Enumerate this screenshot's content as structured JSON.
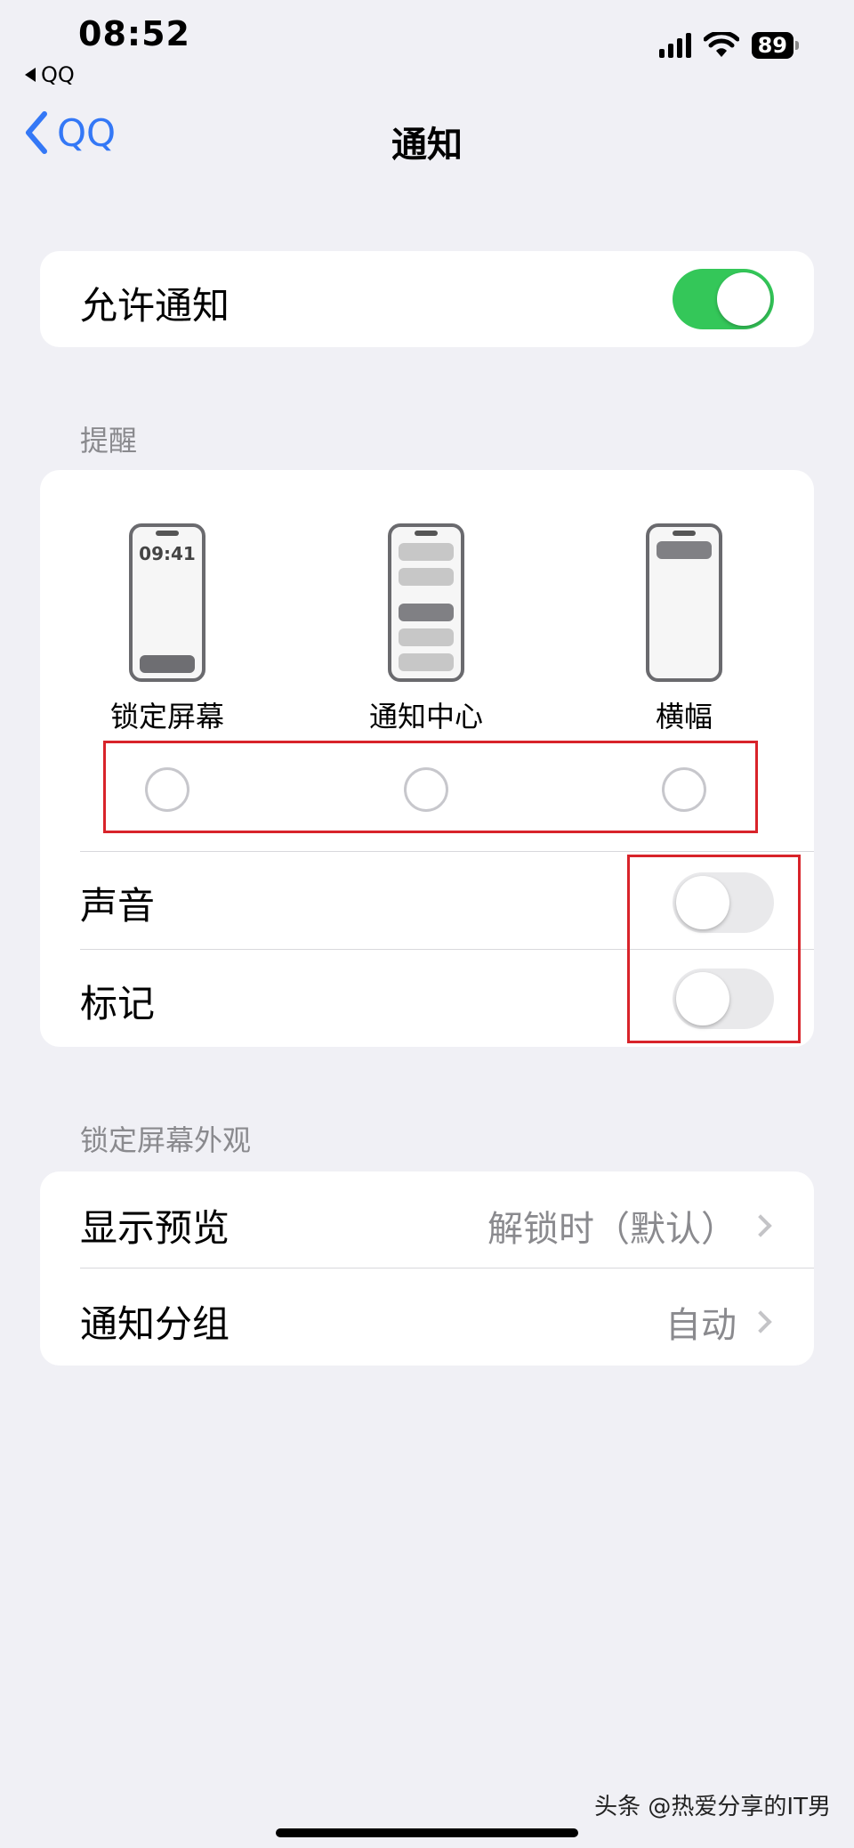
{
  "status_bar": {
    "time": "08:52",
    "back_app": "QQ",
    "battery": "89"
  },
  "nav": {
    "back_label": "QQ",
    "title": "通知"
  },
  "allow_notifications": {
    "label": "允许通知",
    "enabled": true
  },
  "alerts": {
    "header": "提醒",
    "options": [
      {
        "label": "锁定屏幕",
        "selected": false,
        "preview_clock": "09:41"
      },
      {
        "label": "通知中心",
        "selected": false
      },
      {
        "label": "横幅",
        "selected": false
      }
    ],
    "sounds": {
      "label": "声音",
      "enabled": false
    },
    "badges": {
      "label": "标记",
      "enabled": false
    }
  },
  "lock_screen": {
    "header": "锁定屏幕外观",
    "show_previews": {
      "label": "显示预览",
      "value": "解锁时（默认）"
    },
    "grouping": {
      "label": "通知分组",
      "value": "自动"
    }
  },
  "watermark": "头条 @热爱分享的IT男",
  "colors": {
    "accent": "#3478f6",
    "toggle_on": "#34c759",
    "highlight": "#d8232a"
  }
}
